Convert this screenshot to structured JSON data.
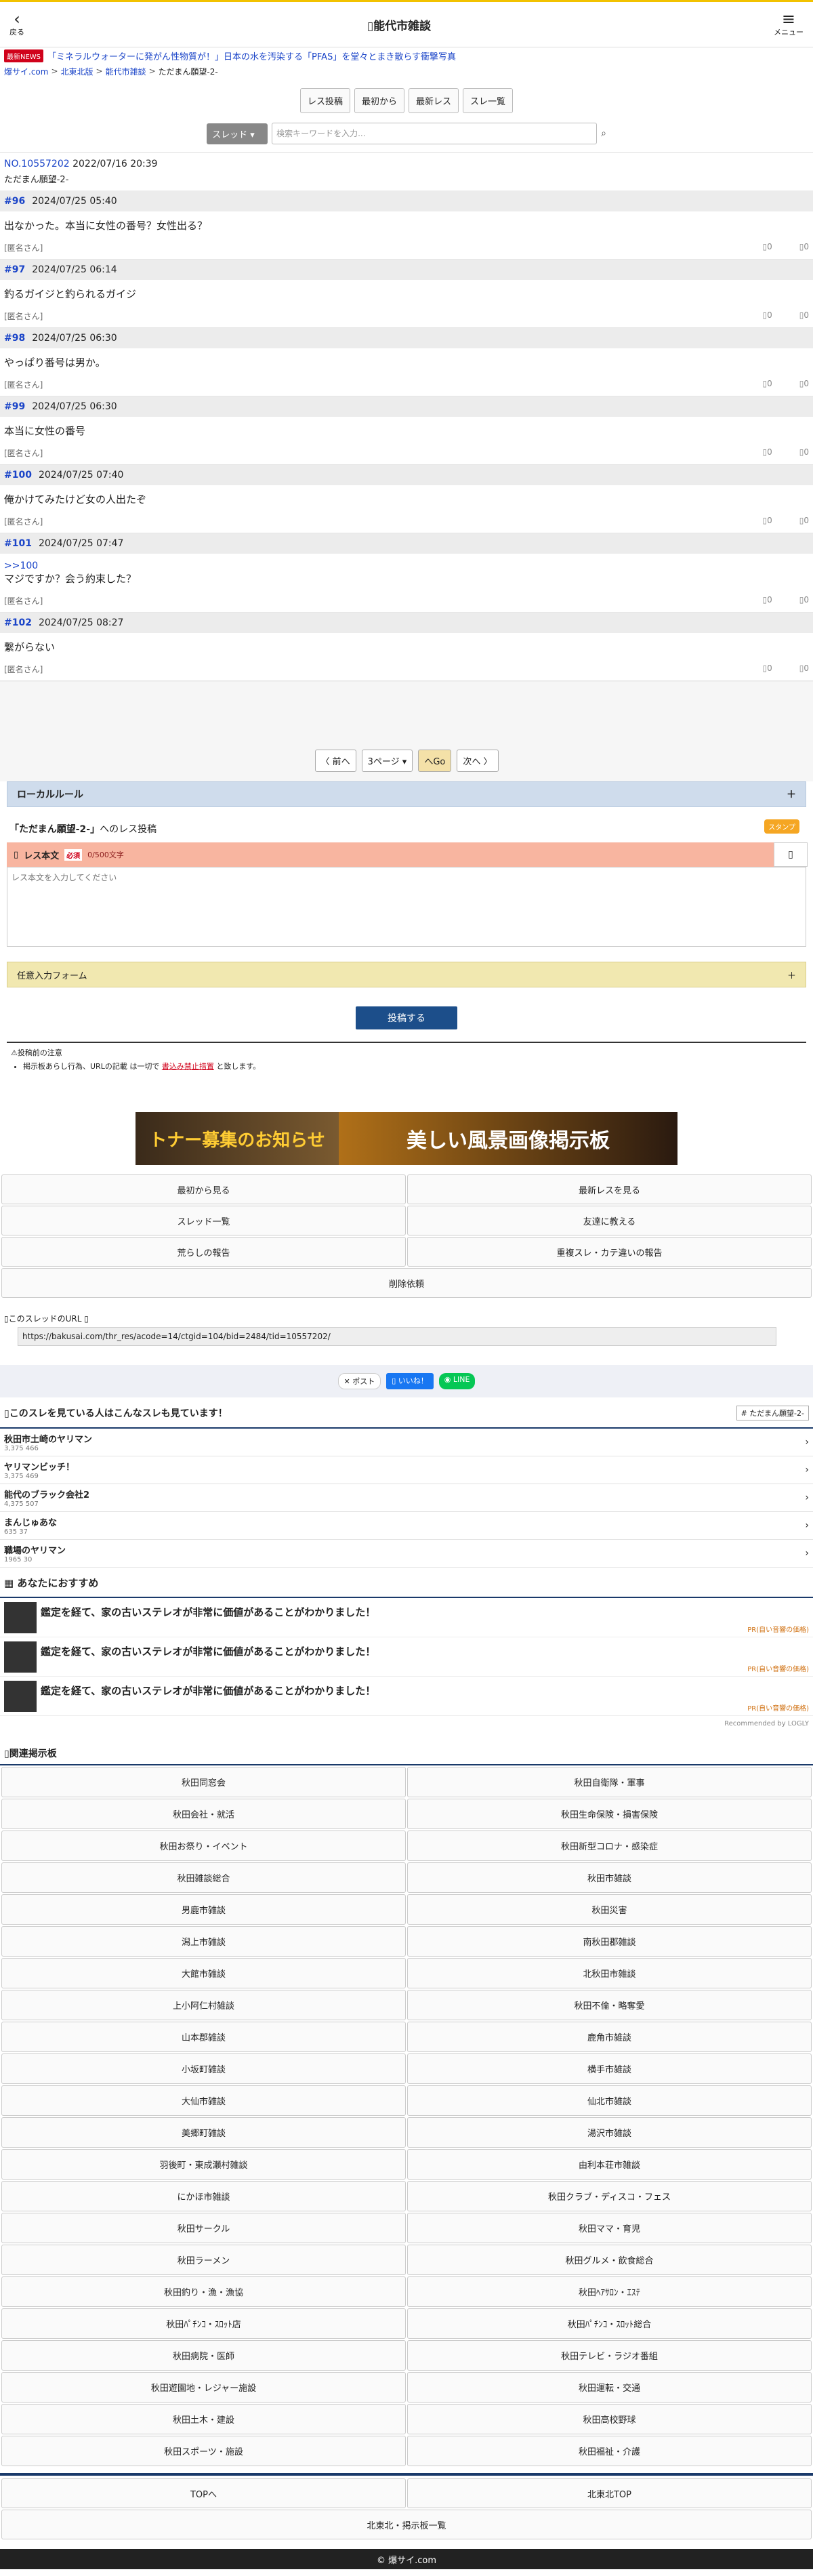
{
  "header": {
    "back": "戻る",
    "title": "能代市雑談",
    "menu": "メニュー"
  },
  "news": {
    "tag": "最新NEWS",
    "text": "「ミネラルウォーターに発がん性物質が！」日本の水を汚染する「PFAS」を堂々とまき散らす衝撃写真"
  },
  "breadcrumb": [
    "爆サイ.com",
    "北東北版",
    "能代市雑談",
    "ただまん願望-2-"
  ],
  "actions": [
    "レス投稿",
    "最初から",
    "最新レス",
    "スレ一覧"
  ],
  "search": {
    "select": "スレッド",
    "placeholder": "検索キーワードを入力..."
  },
  "thread": {
    "no": "NO.10557202",
    "date": "2022/07/16 20:39",
    "title": "ただまん願望-2-"
  },
  "posts": [
    {
      "num": "#96",
      "date": "2024/07/25 05:40",
      "anchor": "",
      "text": "出なかった。本当に女性の番号？女性出る？",
      "name": "[匿名さん]",
      "up": "0",
      "down": "0"
    },
    {
      "num": "#97",
      "date": "2024/07/25 06:14",
      "anchor": "",
      "text": "釣るガイジと釣られるガイジ",
      "name": "[匿名さん]",
      "up": "0",
      "down": "0"
    },
    {
      "num": "#98",
      "date": "2024/07/25 06:30",
      "anchor": "",
      "text": "やっぱり番号は男か。",
      "name": "[匿名さん]",
      "up": "0",
      "down": "0"
    },
    {
      "num": "#99",
      "date": "2024/07/25 06:30",
      "anchor": "",
      "text": "本当に女性の番号",
      "name": "[匿名さん]",
      "up": "0",
      "down": "0"
    },
    {
      "num": "#100",
      "date": "2024/07/25 07:40",
      "anchor": "",
      "text": "俺かけてみたけど女の人出たぞ",
      "name": "[匿名さん]",
      "up": "0",
      "down": "0"
    },
    {
      "num": "#101",
      "date": "2024/07/25 07:47",
      "anchor": ">>100",
      "text": "マジですか？会う約束した？",
      "name": "[匿名さん]",
      "up": "0",
      "down": "0"
    },
    {
      "num": "#102",
      "date": "2024/07/25 08:27",
      "anchor": "",
      "text": "繋がらない",
      "name": "[匿名さん]",
      "up": "0",
      "down": "0"
    }
  ],
  "pager": {
    "prev": "〈 前へ",
    "page": "3ページ",
    "go": "へGo",
    "next": "次へ 〉"
  },
  "local_rule": "ローカルルール",
  "reply_form": {
    "thread": "「ただまん願望-2-」",
    "rest": "へのレス投稿",
    "label": "レス本文",
    "req": "必須",
    "count": "0/500文字",
    "placeholder": "レス本文を入力してください",
    "stamp": "スタンプ",
    "optional": "任意入力フォーム",
    "submit": "投稿する"
  },
  "notice": {
    "title": "投稿前の注意",
    "items_prefix": "掲示板あらし行為",
    "items_mid": "URLの記載",
    "items_mid2": "は一切で",
    "items_red": "書込み禁止措置",
    "items_suffix": "と致します。"
  },
  "banner": {
    "left": "トナー募集のお知らせ",
    "right": "美しい風景画像掲示板"
  },
  "menu_buttons": [
    "最初から見る",
    "最新レスを見る",
    "スレッド一覧",
    "友達に教える",
    "荒らしの報告",
    "重複スレ・カテ違いの報告",
    "削除依頼"
  ],
  "url": {
    "label": "このスレッドのURL",
    "value": "https://bakusai.com/thr_res/acode=14/ctgid=104/bid=2484/tid=10557202/"
  },
  "share": {
    "x": "ポスト",
    "fb": "いいね！",
    "line": "LINE"
  },
  "others": {
    "title": "このスレを見ている人はこんなスレも見ています！",
    "tag": "# ただまん願望-2-",
    "items": [
      {
        "t": "秋田市土崎のヤリマン",
        "m": "3,375  466"
      },
      {
        "t": "ヤリマンビッチ！",
        "m": "3,375  469"
      },
      {
        "t": "能代のブラック会社2",
        "m": "4,375  507"
      },
      {
        "t": "まんじゅあな",
        "m": "635  37"
      },
      {
        "t": "職場のヤリマン",
        "m": "1965  30"
      }
    ]
  },
  "recommend": {
    "title": "あなたにおすすめ",
    "items": [
      "鑑定を経て、家の古いステレオが非常に価値があることがわかりました！",
      "鑑定を経て、家の古いステレオが非常に価値があることがわかりました！",
      "鑑定を経て、家の古いステレオが非常に価値があることがわかりました！"
    ],
    "pr": "PR(自い音響の価格)",
    "by": "Recommended by LOGLY"
  },
  "related": {
    "title": "関連掲示板",
    "items": [
      "秋田同窓会",
      "秋田自衛隊・軍事",
      "秋田会社・就活",
      "秋田生命保険・損害保険",
      "秋田お祭り・イベント",
      "秋田新型コロナ・感染症",
      "秋田雑談総合",
      "秋田市雑談",
      "男鹿市雑談",
      "秋田災害",
      "潟上市雑談",
      "南秋田郡雑談",
      "大館市雑談",
      "北秋田市雑談",
      "上小阿仁村雑談",
      "秋田不倫・略奪愛",
      "山本郡雑談",
      "鹿角市雑談",
      "小坂町雑談",
      "横手市雑談",
      "大仙市雑談",
      "仙北市雑談",
      "美郷町雑談",
      "湯沢市雑談",
      "羽後町・東成瀬村雑談",
      "由利本荘市雑談",
      "にかほ市雑談",
      "秋田クラブ・ディスコ・フェス",
      "秋田サークル",
      "秋田ママ・育児",
      "秋田ラーメン",
      "秋田グルメ・飲食総合",
      "秋田釣り・漁・漁協",
      "秋田ﾍｱｻﾛﾝ・ｴｽﾃ",
      "秋田ﾊﾟﾁﾝｺ・ｽﾛｯﾄ店",
      "秋田ﾊﾟﾁﾝｺ・ｽﾛｯﾄ総合",
      "秋田病院・医師",
      "秋田テレビ・ラジオ番組",
      "秋田遊園地・レジャー施設",
      "秋田運転・交通",
      "秋田土木・建設",
      "秋田高校野球",
      "秋田スポーツ・施設",
      "秋田福祉・介護"
    ]
  },
  "footer": {
    "top": "TOPへ",
    "region_top": "北東北TOP",
    "list": "北東北・掲示板一覧",
    "copy": "© 爆サイ.com"
  }
}
